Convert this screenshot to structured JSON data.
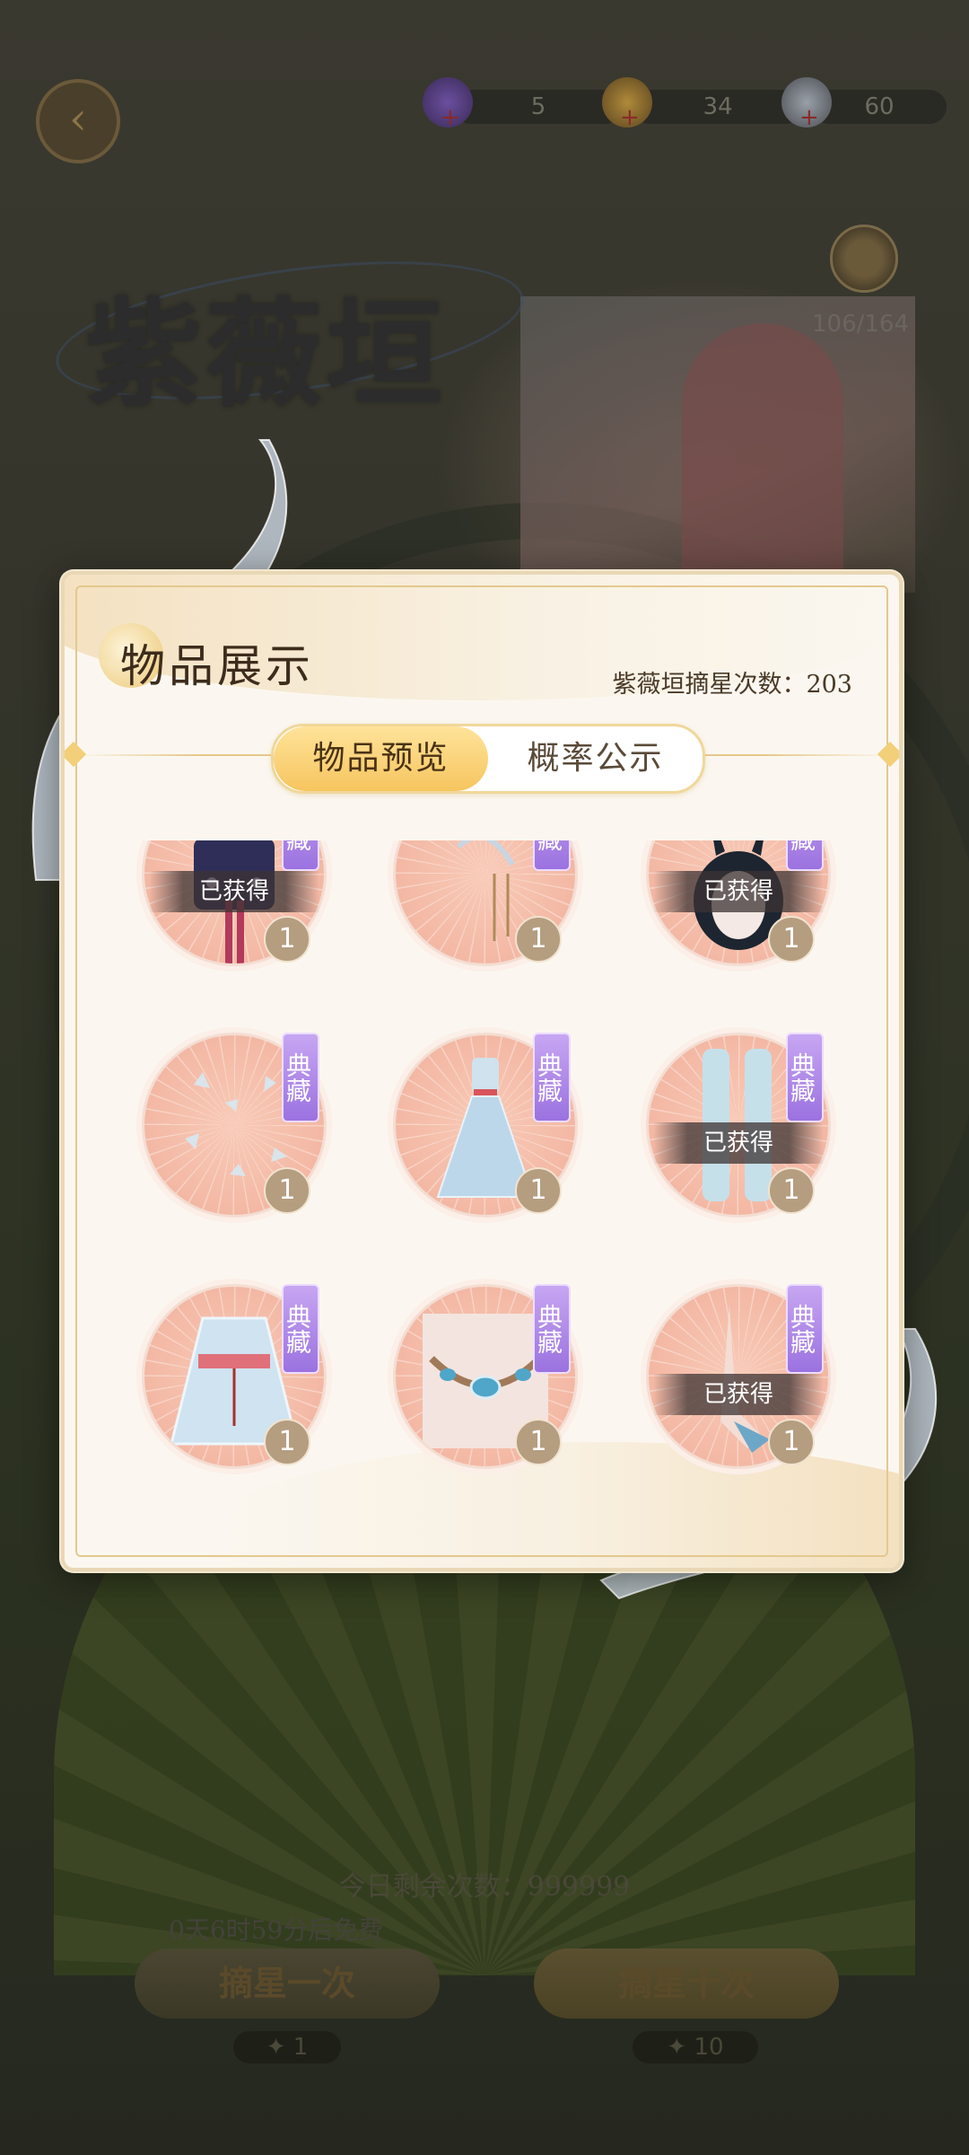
{
  "header": {
    "back_label": "back",
    "currencies": [
      {
        "icon": "grape-currency-icon",
        "value": "5",
        "color": "#6b4fa0"
      },
      {
        "icon": "gold-ingot-currency-icon",
        "value": "34",
        "color": "#b08a3a"
      },
      {
        "icon": "pearl-currency-icon",
        "value": "60",
        "color": "#9aa0a8"
      }
    ]
  },
  "banner": {
    "title": "紫薇垣",
    "progress": "106/164"
  },
  "bottom": {
    "today_remaining": "今日剩余次数：999999",
    "free_timer": "0天6时59分后免费",
    "pull_once": "摘星一次",
    "pull_ten": "摘星十次",
    "cost_once": "1",
    "cost_ten": "10"
  },
  "modal": {
    "title": "物品展示",
    "count_label": "紫薇垣摘星次数：",
    "count_value": "203",
    "tabs": [
      {
        "label": "物品预览",
        "active": true
      },
      {
        "label": "概率公示",
        "active": false
      }
    ],
    "owned_label": "已获得",
    "badge_text": "典藏",
    "items": [
      {
        "name": "dark-outfit-icon",
        "quantity": "1",
        "owned": true
      },
      {
        "name": "hairpin-tassel-icon",
        "quantity": "1",
        "owned": false
      },
      {
        "name": "bunny-ear-hair-icon",
        "quantity": "1",
        "owned": true
      },
      {
        "name": "ice-crystal-effect-icon",
        "quantity": "1",
        "owned": false
      },
      {
        "name": "blue-gown-icon",
        "quantity": "1",
        "owned": false
      },
      {
        "name": "blue-stockings-icon",
        "quantity": "1",
        "owned": true
      },
      {
        "name": "hanfu-top-icon",
        "quantity": "1",
        "owned": false
      },
      {
        "name": "gem-necklace-icon",
        "quantity": "1",
        "owned": false
      },
      {
        "name": "sandal-shoe-icon",
        "quantity": "1",
        "owned": true
      }
    ]
  }
}
